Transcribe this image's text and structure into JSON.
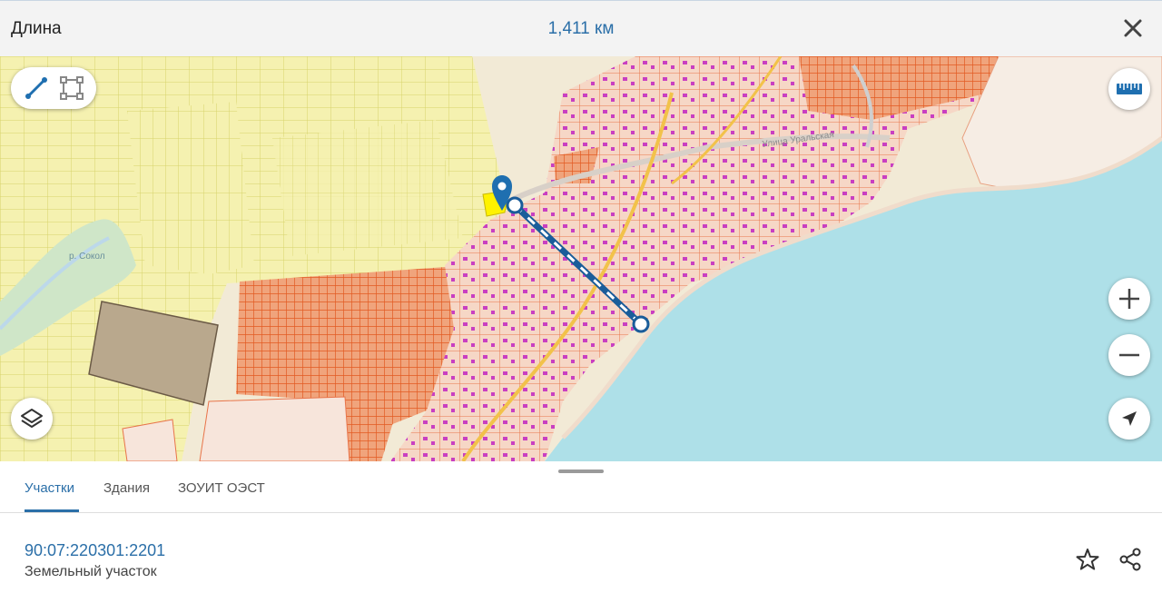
{
  "header": {
    "title": "Длина",
    "measurement": "1,411 км"
  },
  "map": {
    "place_label": "р. Сокол",
    "street_label": "Улица Уральская"
  },
  "tabs": [
    {
      "label": "Участки",
      "active": true
    },
    {
      "label": "Здания",
      "active": false
    },
    {
      "label": "ЗОУИТ ОЭСТ",
      "active": false
    }
  ],
  "result": {
    "cadastral_number": "90:07:220301:2201",
    "type": "Земельный участок"
  },
  "icons": {
    "close": "close-icon",
    "line_tool": "line-measure-icon",
    "area_tool": "area-measure-icon",
    "ruler": "ruler-icon",
    "layers": "layers-icon",
    "zoom_in": "plus-icon",
    "zoom_out": "minus-icon",
    "locate": "navigation-arrow-icon",
    "favorite": "star-icon",
    "share": "share-icon",
    "marker": "map-pin-icon"
  },
  "colors": {
    "accent": "#2b6fa8",
    "water": "#aee0e8",
    "parcel_orange": "#e8602c",
    "parcel_yellow": "#f3ee9e",
    "building_magenta": "#c93fc1"
  }
}
